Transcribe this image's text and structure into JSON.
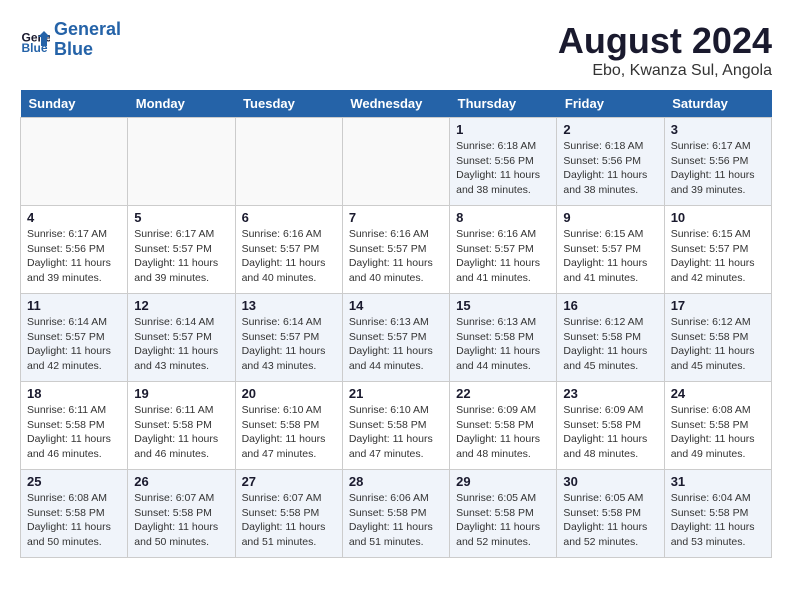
{
  "logo": {
    "text_general": "General",
    "text_blue": "Blue"
  },
  "title": "August 2024",
  "subtitle": "Ebo, Kwanza Sul, Angola",
  "days_of_week": [
    "Sunday",
    "Monday",
    "Tuesday",
    "Wednesday",
    "Thursday",
    "Friday",
    "Saturday"
  ],
  "weeks": [
    [
      {
        "day": "",
        "empty": true
      },
      {
        "day": "",
        "empty": true
      },
      {
        "day": "",
        "empty": true
      },
      {
        "day": "",
        "empty": true
      },
      {
        "day": "1",
        "sunrise": "6:18 AM",
        "sunset": "5:56 PM",
        "daylight": "11 hours and 38 minutes."
      },
      {
        "day": "2",
        "sunrise": "6:18 AM",
        "sunset": "5:56 PM",
        "daylight": "11 hours and 38 minutes."
      },
      {
        "day": "3",
        "sunrise": "6:17 AM",
        "sunset": "5:56 PM",
        "daylight": "11 hours and 39 minutes."
      }
    ],
    [
      {
        "day": "4",
        "sunrise": "6:17 AM",
        "sunset": "5:56 PM",
        "daylight": "11 hours and 39 minutes."
      },
      {
        "day": "5",
        "sunrise": "6:17 AM",
        "sunset": "5:57 PM",
        "daylight": "11 hours and 39 minutes."
      },
      {
        "day": "6",
        "sunrise": "6:16 AM",
        "sunset": "5:57 PM",
        "daylight": "11 hours and 40 minutes."
      },
      {
        "day": "7",
        "sunrise": "6:16 AM",
        "sunset": "5:57 PM",
        "daylight": "11 hours and 40 minutes."
      },
      {
        "day": "8",
        "sunrise": "6:16 AM",
        "sunset": "5:57 PM",
        "daylight": "11 hours and 41 minutes."
      },
      {
        "day": "9",
        "sunrise": "6:15 AM",
        "sunset": "5:57 PM",
        "daylight": "11 hours and 41 minutes."
      },
      {
        "day": "10",
        "sunrise": "6:15 AM",
        "sunset": "5:57 PM",
        "daylight": "11 hours and 42 minutes."
      }
    ],
    [
      {
        "day": "11",
        "sunrise": "6:14 AM",
        "sunset": "5:57 PM",
        "daylight": "11 hours and 42 minutes."
      },
      {
        "day": "12",
        "sunrise": "6:14 AM",
        "sunset": "5:57 PM",
        "daylight": "11 hours and 43 minutes."
      },
      {
        "day": "13",
        "sunrise": "6:14 AM",
        "sunset": "5:57 PM",
        "daylight": "11 hours and 43 minutes."
      },
      {
        "day": "14",
        "sunrise": "6:13 AM",
        "sunset": "5:57 PM",
        "daylight": "11 hours and 44 minutes."
      },
      {
        "day": "15",
        "sunrise": "6:13 AM",
        "sunset": "5:58 PM",
        "daylight": "11 hours and 44 minutes."
      },
      {
        "day": "16",
        "sunrise": "6:12 AM",
        "sunset": "5:58 PM",
        "daylight": "11 hours and 45 minutes."
      },
      {
        "day": "17",
        "sunrise": "6:12 AM",
        "sunset": "5:58 PM",
        "daylight": "11 hours and 45 minutes."
      }
    ],
    [
      {
        "day": "18",
        "sunrise": "6:11 AM",
        "sunset": "5:58 PM",
        "daylight": "11 hours and 46 minutes."
      },
      {
        "day": "19",
        "sunrise": "6:11 AM",
        "sunset": "5:58 PM",
        "daylight": "11 hours and 46 minutes."
      },
      {
        "day": "20",
        "sunrise": "6:10 AM",
        "sunset": "5:58 PM",
        "daylight": "11 hours and 47 minutes."
      },
      {
        "day": "21",
        "sunrise": "6:10 AM",
        "sunset": "5:58 PM",
        "daylight": "11 hours and 47 minutes."
      },
      {
        "day": "22",
        "sunrise": "6:09 AM",
        "sunset": "5:58 PM",
        "daylight": "11 hours and 48 minutes."
      },
      {
        "day": "23",
        "sunrise": "6:09 AM",
        "sunset": "5:58 PM",
        "daylight": "11 hours and 48 minutes."
      },
      {
        "day": "24",
        "sunrise": "6:08 AM",
        "sunset": "5:58 PM",
        "daylight": "11 hours and 49 minutes."
      }
    ],
    [
      {
        "day": "25",
        "sunrise": "6:08 AM",
        "sunset": "5:58 PM",
        "daylight": "11 hours and 50 minutes."
      },
      {
        "day": "26",
        "sunrise": "6:07 AM",
        "sunset": "5:58 PM",
        "daylight": "11 hours and 50 minutes."
      },
      {
        "day": "27",
        "sunrise": "6:07 AM",
        "sunset": "5:58 PM",
        "daylight": "11 hours and 51 minutes."
      },
      {
        "day": "28",
        "sunrise": "6:06 AM",
        "sunset": "5:58 PM",
        "daylight": "11 hours and 51 minutes."
      },
      {
        "day": "29",
        "sunrise": "6:05 AM",
        "sunset": "5:58 PM",
        "daylight": "11 hours and 52 minutes."
      },
      {
        "day": "30",
        "sunrise": "6:05 AM",
        "sunset": "5:58 PM",
        "daylight": "11 hours and 52 minutes."
      },
      {
        "day": "31",
        "sunrise": "6:04 AM",
        "sunset": "5:58 PM",
        "daylight": "11 hours and 53 minutes."
      }
    ]
  ],
  "labels": {
    "sunrise_prefix": "Sunrise:",
    "sunset_prefix": "Sunset:",
    "daylight_label": "Daylight:"
  }
}
